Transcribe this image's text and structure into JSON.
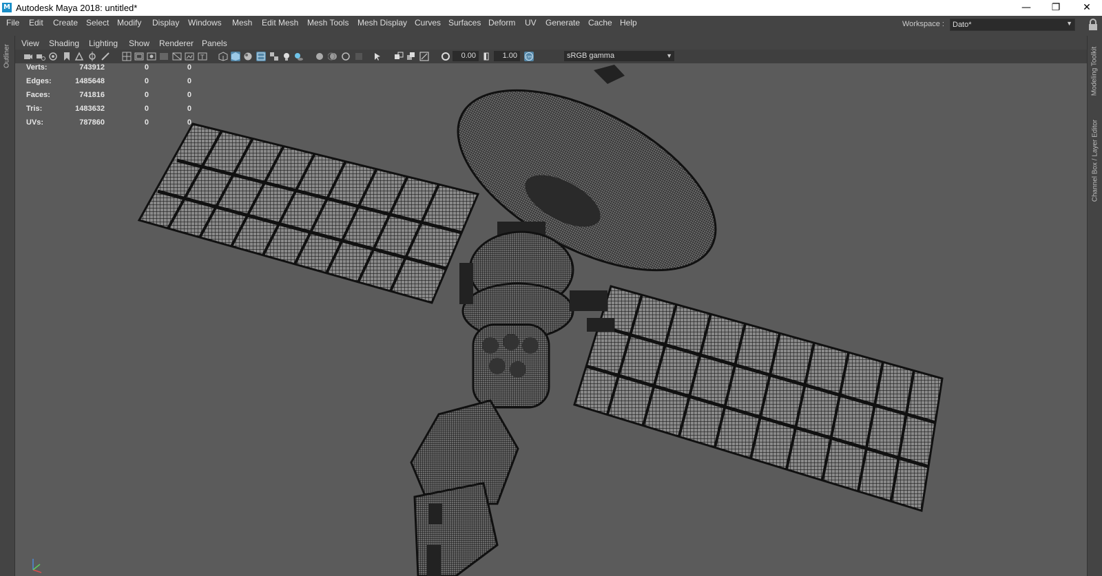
{
  "window": {
    "title": "Autodesk Maya 2018: untitled*",
    "app_icon_letter": "M",
    "controls": [
      "minimize-icon",
      "restore-icon",
      "close-icon"
    ]
  },
  "menubar": {
    "items": [
      "File",
      "Edit",
      "Create",
      "Select",
      "Modify",
      "Display",
      "Windows",
      "Mesh",
      "Edit Mesh",
      "Mesh Tools",
      "Mesh Display",
      "Curves",
      "Surfaces",
      "Deform",
      "UV",
      "Generate",
      "Cache",
      "Help"
    ]
  },
  "workspace": {
    "label": "Workspace :",
    "value": "Dato*"
  },
  "side_tabs": {
    "left": "Outliner",
    "right_top": "Modeling Toolkit",
    "right_bottom": "Channel Box / Layer Editor"
  },
  "panel_menu": {
    "items": [
      "View",
      "Shading",
      "Lighting",
      "Show",
      "Renderer",
      "Panels"
    ]
  },
  "toolbar": {
    "exposure": "0.00",
    "gamma": "1.00",
    "color_space": "sRGB gamma",
    "active_color": "#5285a6"
  },
  "hud": {
    "rows": [
      {
        "label": "Verts:",
        "v1": "743912",
        "v2": "0",
        "v3": "0"
      },
      {
        "label": "Edges:",
        "v1": "1485648",
        "v2": "0",
        "v3": "0"
      },
      {
        "label": "Faces:",
        "v1": "741816",
        "v2": "0",
        "v3": "0"
      },
      {
        "label": "Tris:",
        "v1": "1483632",
        "v2": "0",
        "v3": "0"
      },
      {
        "label": "UVs:",
        "v1": "787860",
        "v2": "0",
        "v3": "0"
      }
    ]
  },
  "viewport": {
    "background": "#5b5b5b",
    "content": "satellite-wireframe-model"
  }
}
